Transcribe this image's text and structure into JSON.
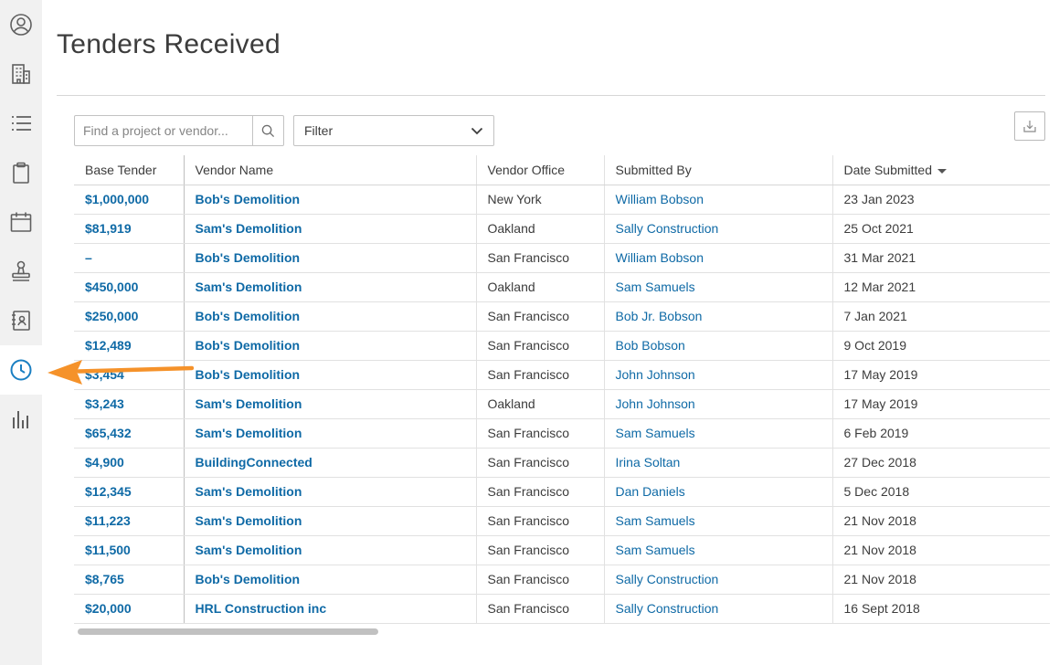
{
  "page": {
    "title": "Tenders Received"
  },
  "toolbar": {
    "search_placeholder": "Find a project or vendor...",
    "filter_label": "Filter"
  },
  "sidebar": {
    "items": [
      {
        "icon": "user-circle-icon"
      },
      {
        "icon": "building-icon"
      },
      {
        "icon": "list-icon"
      },
      {
        "icon": "clipboard-icon"
      },
      {
        "icon": "calendar-icon"
      },
      {
        "icon": "stamp-icon"
      },
      {
        "icon": "address-book-icon"
      },
      {
        "icon": "clock-icon",
        "active": true
      },
      {
        "icon": "bar-chart-icon"
      }
    ]
  },
  "table": {
    "columns": [
      "Base Tender",
      "Vendor Name",
      "Vendor Office",
      "Submitted By",
      "Date Submitted"
    ],
    "sort_column": "Date Submitted",
    "rows": [
      {
        "base": "$1,000,000",
        "vendor": "Bob's Demolition",
        "office": "New York",
        "by": "William Bobson",
        "date": "23 Jan 2023"
      },
      {
        "base": "$81,919",
        "vendor": "Sam's Demolition",
        "office": "Oakland",
        "by": "Sally Construction",
        "date": "25 Oct 2021"
      },
      {
        "base": "–",
        "vendor": "Bob's Demolition",
        "office": "San Francisco",
        "by": "William Bobson",
        "date": "31 Mar 2021"
      },
      {
        "base": "$450,000",
        "vendor": "Sam's Demolition",
        "office": "Oakland",
        "by": "Sam Samuels",
        "date": "12 Mar 2021"
      },
      {
        "base": "$250,000",
        "vendor": "Bob's Demolition",
        "office": "San Francisco",
        "by": "Bob Jr. Bobson",
        "date": "7 Jan 2021"
      },
      {
        "base": "$12,489",
        "vendor": "Bob's Demolition",
        "office": "San Francisco",
        "by": "Bob Bobson",
        "date": "9 Oct 2019"
      },
      {
        "base": "$3,454",
        "vendor": "Bob's Demolition",
        "office": "San Francisco",
        "by": "John Johnson",
        "date": "17 May 2019"
      },
      {
        "base": "$3,243",
        "vendor": "Sam's Demolition",
        "office": "Oakland",
        "by": "John Johnson",
        "date": "17 May 2019"
      },
      {
        "base": "$65,432",
        "vendor": "Sam's Demolition",
        "office": "San Francisco",
        "by": "Sam Samuels",
        "date": "6 Feb 2019"
      },
      {
        "base": "$4,900",
        "vendor": "BuildingConnected",
        "office": "San Francisco",
        "by": "Irina Soltan",
        "date": "27 Dec 2018"
      },
      {
        "base": "$12,345",
        "vendor": "Sam's Demolition",
        "office": "San Francisco",
        "by": "Dan Daniels",
        "date": "5 Dec 2018"
      },
      {
        "base": "$11,223",
        "vendor": "Sam's Demolition",
        "office": "San Francisco",
        "by": "Sam Samuels",
        "date": "21 Nov 2018"
      },
      {
        "base": "$11,500",
        "vendor": "Sam's Demolition",
        "office": "San Francisco",
        "by": "Sam Samuels",
        "date": "21 Nov 2018"
      },
      {
        "base": "$8,765",
        "vendor": "Bob's Demolition",
        "office": "San Francisco",
        "by": "Sally Construction",
        "date": "21 Nov 2018"
      },
      {
        "base": "$20,000",
        "vendor": "HRL Construction inc",
        "office": "San Francisco",
        "by": "Sally Construction",
        "date": "16 Sept 2018"
      }
    ]
  },
  "colors": {
    "link": "#0f6aa6",
    "active_icon": "#1a7fc2",
    "sidebar_bg": "#f1f1f1",
    "annotation_arrow": "#f5922a"
  }
}
